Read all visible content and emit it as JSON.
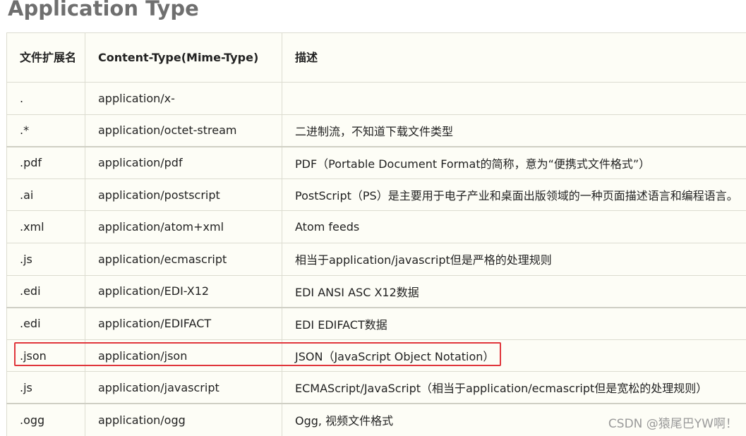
{
  "heading": "Application Type",
  "table": {
    "headers": [
      "文件扩展名",
      "Content-Type(Mime-Type)",
      "描述"
    ],
    "rows": [
      {
        "ext": ".",
        "mime": "application/x-",
        "desc": ""
      },
      {
        "ext": ".*",
        "mime": "application/octet-stream",
        "desc": "二进制流，不知道下载文件类型"
      },
      {
        "ext": ".pdf",
        "mime": "application/pdf",
        "desc": "PDF（Portable Document Format的简称，意为“便携式文件格式”）"
      },
      {
        "ext": ".ai",
        "mime": "application/postscript",
        "desc": "PostScript（PS）是主要用于电子产业和桌面出版领域的一种页面描述语言和编程语言。"
      },
      {
        "ext": ".xml",
        "mime": "application/atom+xml",
        "desc": "Atom feeds"
      },
      {
        "ext": ".js",
        "mime": "application/ecmascript",
        "desc": "相当于application/javascript但是严格的处理规则"
      },
      {
        "ext": ".edi",
        "mime": "application/EDI-X12",
        "desc": "EDI ANSI ASC X12数据"
      },
      {
        "ext": ".edi",
        "mime": "application/EDIFACT",
        "desc": "EDI EDIFACT数据"
      },
      {
        "ext": ".json",
        "mime": "application/json",
        "desc": "JSON（JavaScript Object Notation）"
      },
      {
        "ext": ".js",
        "mime": "application/javascript",
        "desc": "ECMAScript/JavaScript（相当于application/ecmascript但是宽松的处理规则）"
      },
      {
        "ext": ".ogg",
        "mime": "application/ogg",
        "desc": "Ogg, 视频文件格式"
      }
    ]
  },
  "watermark": "CSDN @猿尾巴YW啊！",
  "colors": {
    "heading": "#6f6f6f",
    "table_bg": "#fdfdf6",
    "border": "#dcdcd0",
    "highlight": "#e0363c"
  }
}
